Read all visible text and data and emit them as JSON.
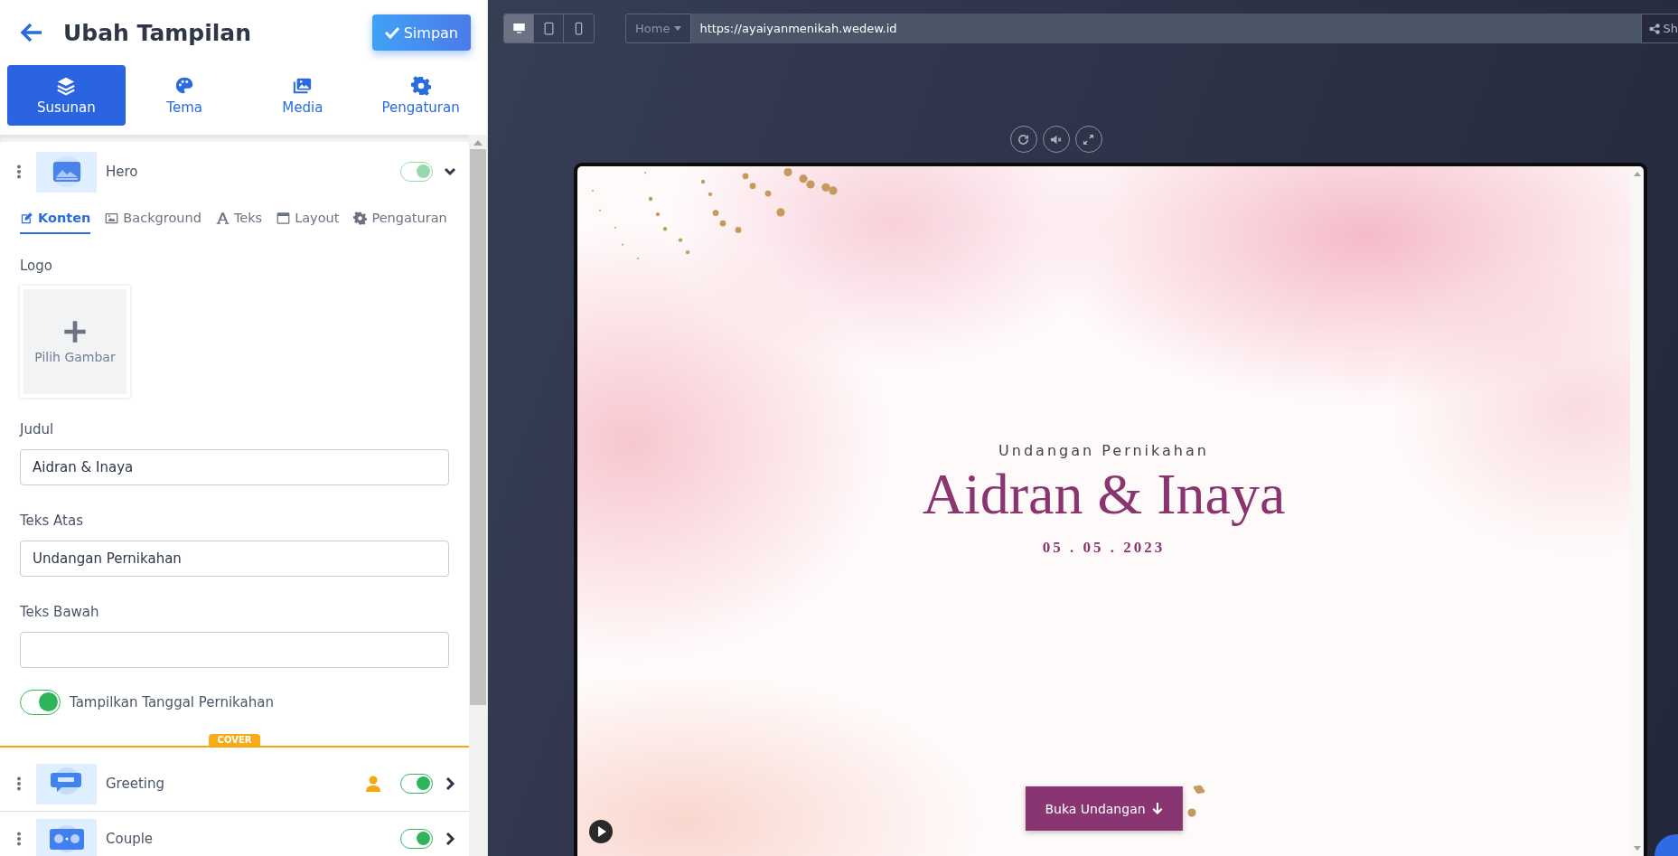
{
  "header": {
    "title": "Ubah Tampilan",
    "save_button": "Simpan"
  },
  "main_tabs": [
    {
      "label": "Susunan",
      "selected": true
    },
    {
      "label": "Tema",
      "selected": false
    },
    {
      "label": "Media",
      "selected": false
    },
    {
      "label": "Pengaturan",
      "selected": false
    }
  ],
  "sections": [
    {
      "name": "Hero",
      "kind": "hero",
      "on": true,
      "disabled": true,
      "expanded": true,
      "tabs": [
        {
          "label": "Konten",
          "selected": true
        },
        {
          "label": "Background",
          "selected": false
        },
        {
          "label": "Teks",
          "selected": false
        },
        {
          "label": "Layout",
          "selected": false
        },
        {
          "label": "Pengaturan",
          "selected": false
        }
      ],
      "fields": [
        {
          "kind": "image",
          "label": "Logo",
          "button": "Pilih Gambar"
        },
        {
          "kind": "text",
          "label": "Judul",
          "value": "Aidran & Inaya"
        },
        {
          "kind": "text",
          "label": "Teks Atas",
          "value": "Undangan Pernikahan"
        },
        {
          "kind": "text",
          "label": "Teks Bawah"
        },
        {
          "kind": "switch",
          "label": "Tampilkan Tanggal Pernikahan",
          "on": true
        }
      ],
      "badge": "COVER"
    },
    {
      "name": "Greeting",
      "kind": "greeting",
      "on": true,
      "disabled": false,
      "expanded": false,
      "guest_icon": true
    },
    {
      "name": "Couple",
      "kind": "couple",
      "on": true,
      "disabled": false,
      "expanded": false
    }
  ],
  "preview": {
    "devices": [
      {
        "selected": true
      },
      {
        "selected": false
      },
      {
        "selected": false
      }
    ],
    "page_select": "Home",
    "url": "https://ayaiyanmenikah.wedew.id",
    "share_button": "Sh",
    "hero": {
      "top_text": "Undangan Pernikahan",
      "title": "Aidran & Inaya",
      "date": "05 . 05 . 2023",
      "button": "Buka Undangan"
    }
  }
}
